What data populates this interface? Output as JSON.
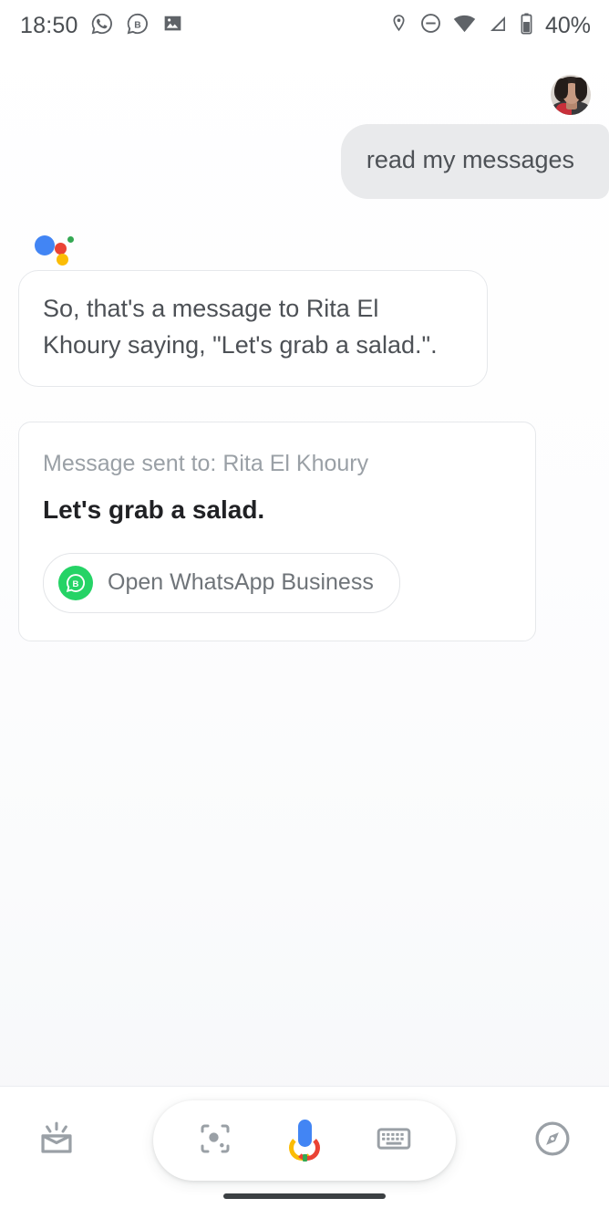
{
  "status_bar": {
    "time": "18:50",
    "battery_percent": "40%",
    "left_icons": [
      "whatsapp-icon",
      "whatsapp-business-icon",
      "screenshot-image-icon"
    ],
    "right_icons": [
      "location-pin-icon",
      "do-not-disturb-icon",
      "wifi-icon",
      "cellular-signal-icon",
      "battery-icon"
    ]
  },
  "conversation": {
    "user": {
      "avatar_alt": "user-profile-photo",
      "message": "read my messages"
    },
    "assistant": {
      "logo": "google-assistant-logo",
      "message": "So, that's a message to Rita El Khoury saying, \"Let's grab a salad.\"."
    },
    "result_card": {
      "recipient_line": "Message sent to: Rita El Khoury",
      "message_body": "Let's grab a salad.",
      "action": {
        "label": "Open WhatsApp Business",
        "icon": "whatsapp-business-icon",
        "icon_color": "#25d366"
      }
    }
  },
  "bottom_bar": {
    "snapshot_icon": "snapshot-icon",
    "lens_icon": "google-lens-icon",
    "mic_icon": "google-mic-icon",
    "keyboard_icon": "keyboard-icon",
    "explore_icon": "explore-compass-icon"
  },
  "colors": {
    "google_blue": "#4285f4",
    "google_red": "#ea4335",
    "google_yellow": "#fbbc05",
    "google_green": "#34a853",
    "whatsapp_green": "#25d366",
    "user_bubble": "#e9eaec",
    "muted_text": "#9aa0a6"
  }
}
